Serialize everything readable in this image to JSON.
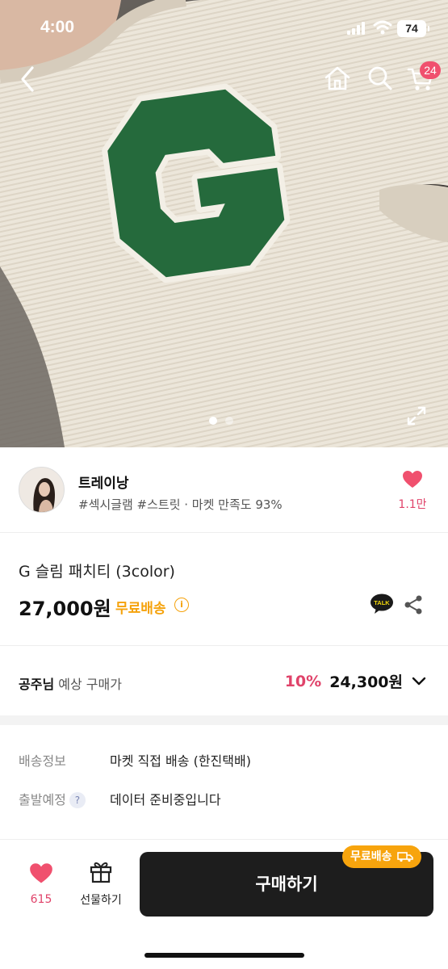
{
  "status_bar": {
    "time": "4:00",
    "battery": "74"
  },
  "header": {
    "icons": [
      "back-arrow-icon",
      "home-icon",
      "search-icon",
      "cart-icon"
    ],
    "cart_count": "24"
  },
  "gallery": {
    "total_images": 2,
    "current_index": 1
  },
  "seller": {
    "name": "트레이낭",
    "meta": "#섹시글램 #스트릿 · 마켓 만족도 93%",
    "likes": "1.1만"
  },
  "product": {
    "title": "G 슬림 패치티 (3color)",
    "price": "27,000원",
    "free_shipping": "무료배송",
    "info_icon": "i",
    "talk_label": "TALK"
  },
  "expected_price": {
    "user": "공주님",
    "label": "예상 구매가",
    "discount": "10%",
    "price": "24,300원"
  },
  "shipping": {
    "rows": [
      {
        "key": "배송정보",
        "value": "마켓 직접 배송 (한진택배)"
      },
      {
        "key": "출발예정",
        "value": "데이터 준비중입니다"
      }
    ],
    "help_mark": "?"
  },
  "bottom_bar": {
    "likes": "615",
    "gift_label": "선물하기",
    "buy_label": "구매하기",
    "free_tag": "무료배송"
  },
  "colors": {
    "accent_pink": "#e0436a",
    "badge_pink": "#f0506e",
    "free_orange": "#f5a20b",
    "buy_button": "#1d1d1d"
  }
}
